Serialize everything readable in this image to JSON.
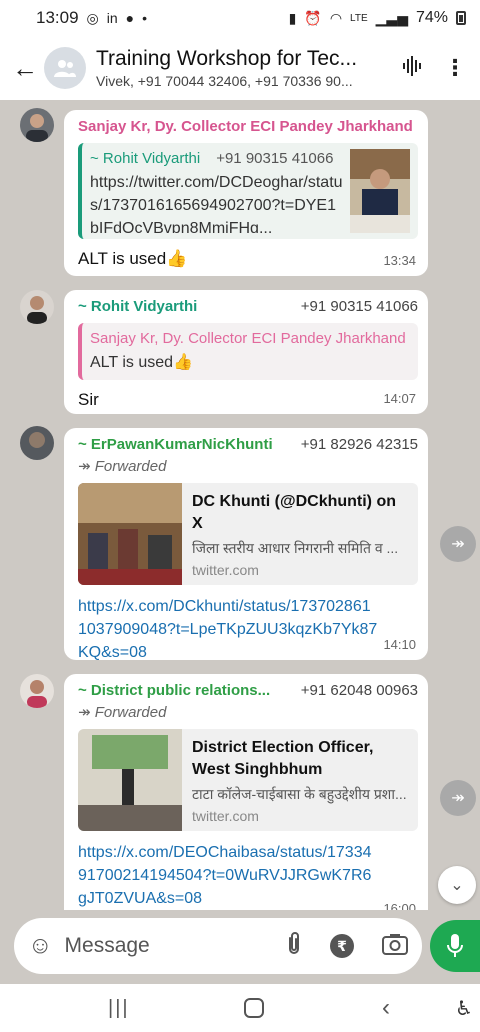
{
  "status_bar": {
    "time": "13:09",
    "network": "LTE",
    "battery": "74%"
  },
  "header": {
    "title": "Training Workshop for Tec...",
    "subtitle": "Vivek, +91 70044 32406, +91 70336 90..."
  },
  "messages": [
    {
      "sender": "Sanjay Kr, Dy. Collector ECI Pandey Jharkhand",
      "sender_color": "#d6558f",
      "quote_sender": "~ Rohit Vidyarthi",
      "quote_phone": "+91 90315 41066",
      "quote_text": "https://twitter.com/DCDeoghar/status/1737016165694902700?t=DYE1bIFdOcVBvpn8MmiFHg...",
      "text": "ALT is used👍",
      "time": "13:34"
    },
    {
      "sender": "~ Rohit Vidyarthi",
      "sender_color": "#1a9b7a",
      "phone": "+91 90315 41066",
      "quote_sender": "Sanjay Kr, Dy. Collector ECI Pandey Jharkhand",
      "quote_text": "ALT is used👍",
      "text": "Sir",
      "time": "14:07"
    },
    {
      "sender": "~ ErPawanKumarNicKhunti",
      "sender_color": "#2f9e46",
      "phone": "+91 82926 42315",
      "forwarded": "Forwarded",
      "link_title": "DC Khunti (@DCkhunti) on X",
      "link_desc": "जिला स्तरीय आधार निगरानी समिति व ...",
      "link_domain": "twitter.com",
      "url": "https://x.com/DCkhunti/status/1737028611037909048?t=LpeTKpZUU3kqzKb7Yk87KQ&s=08",
      "time": "14:10"
    },
    {
      "sender": "~ District public relations...",
      "sender_color": "#2f9e46",
      "phone": "+91 62048 00963",
      "forwarded": "Forwarded",
      "link_title": "District Election Officer, West Singhbhum (@DEOChaibas...",
      "link_desc": "टाटा कॉलेज-चाईबासा के बहुउद्देशीय प्रशा...",
      "link_domain": "twitter.com",
      "url": "https://x.com/DEOChaibasa/status/1733491700214194504?t=0WuRVJJRGwK7R6gJT0ZVUA&s=08",
      "time": "16:00"
    }
  ],
  "input": {
    "placeholder": "Message"
  },
  "colors": {
    "accent_green": "#1ea952",
    "link_blue": "#1a6fb0",
    "chat_background": "#cdc9c4"
  }
}
